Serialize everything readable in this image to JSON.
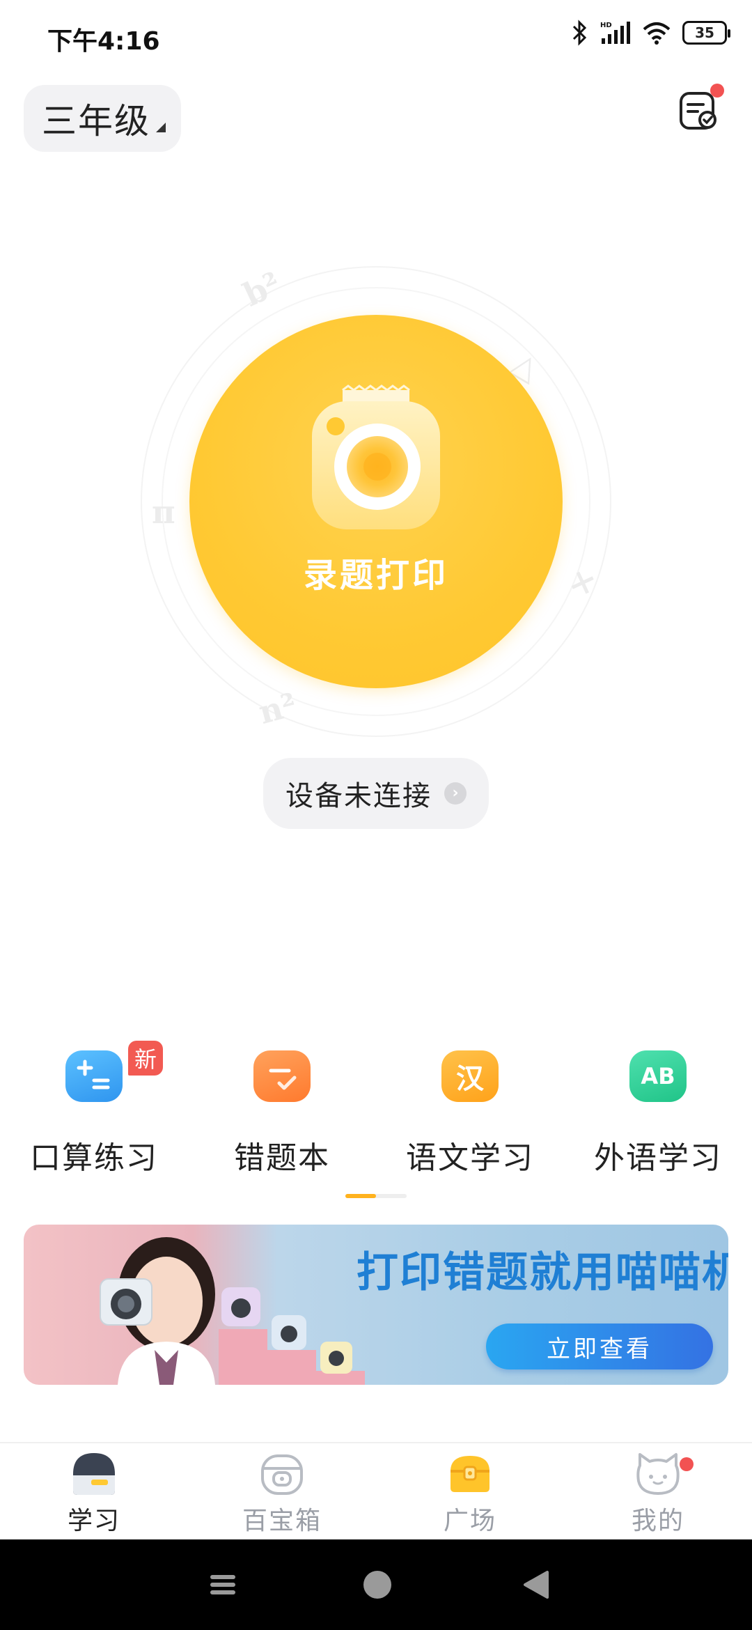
{
  "status_bar": {
    "time": "下午4:16",
    "battery": "35"
  },
  "grade_selector": {
    "label": "三年级"
  },
  "capture": {
    "label": "录题打印"
  },
  "device": {
    "status": "设备未连接"
  },
  "features": [
    {
      "label": "口算练习",
      "icon": "arithmetic-icon",
      "badge": "新",
      "color": "#3aa7f5"
    },
    {
      "label": "错题本",
      "icon": "mistakes-notebook-icon",
      "color": "#ff8a3d"
    },
    {
      "label": "语文学习",
      "icon": "chinese-icon",
      "glyph": "汉",
      "color": "#ffb02a"
    },
    {
      "label": "外语学习",
      "icon": "foreign-language-icon",
      "glyph": "AB",
      "color": "#2fd49a"
    }
  ],
  "banner": {
    "title": "打印错题就用喵喵机",
    "cta": "立即查看"
  },
  "bottom_nav": [
    {
      "label": "学习",
      "icon": "study-icon",
      "active": true
    },
    {
      "label": "百宝箱",
      "icon": "toolbox-icon"
    },
    {
      "label": "广场",
      "icon": "plaza-icon"
    },
    {
      "label": "我的",
      "icon": "profile-cat-icon",
      "has_dot": true
    }
  ],
  "colors": {
    "capture_yellow": "#ffc933",
    "accent_orange": "#ffb21e",
    "badge_red": "#f25a52"
  }
}
